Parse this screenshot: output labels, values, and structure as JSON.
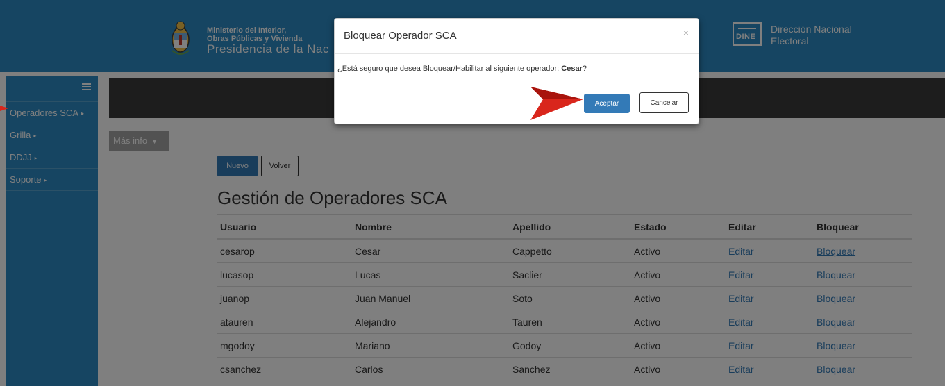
{
  "header": {
    "ministry_line1": "Ministerio del Interior,",
    "ministry_line2": "Obras Públicas y Vivienda",
    "ministry_line3": "Presidencia de la Nac",
    "dine_logo_text": "DINE",
    "dine_line1": "Dirección Nacional",
    "dine_line2": "Electoral"
  },
  "sidebar": {
    "items": [
      {
        "label": "Operadores SCA"
      },
      {
        "label": "Grilla"
      },
      {
        "label": "DDJJ"
      },
      {
        "label": "Soporte"
      }
    ]
  },
  "toolbar": {
    "mas_info": "Más info",
    "nuevo": "Nuevo",
    "volver": "Volver"
  },
  "page": {
    "title": "Gestión de Operadores SCA"
  },
  "table": {
    "headers": [
      "Usuario",
      "Nombre",
      "Apellido",
      "Estado",
      "Editar",
      "Bloquear"
    ],
    "rows": [
      [
        "cesarop",
        "Cesar",
        "Cappetto",
        "Activo",
        "Editar",
        "Bloquear"
      ],
      [
        "lucasop",
        "Lucas",
        "Saclier",
        "Activo",
        "Editar",
        "Bloquear"
      ],
      [
        "juanop",
        "Juan Manuel",
        "Soto",
        "Activo",
        "Editar",
        "Bloquear"
      ],
      [
        "atauren",
        "Alejandro",
        "Tauren",
        "Activo",
        "Editar",
        "Bloquear"
      ],
      [
        "mgodoy",
        "Mariano",
        "Godoy",
        "Activo",
        "Editar",
        "Bloquear"
      ],
      [
        "csanchez",
        "Carlos",
        "Sanchez",
        "Activo",
        "Editar",
        "Bloquear"
      ]
    ]
  },
  "modal": {
    "title": "Bloquear Operador SCA",
    "close": "×",
    "message": "¿Está seguro que desea Bloquear/Habilitar al siguiente operador: ",
    "operator": "Cesar",
    "message_end": "?",
    "accept": "Aceptar",
    "cancel": "Cancelar"
  },
  "colors": {
    "header_blue": "#2d8bc4",
    "primary": "#337ab7",
    "dark_bar": "#3a3a3a",
    "arrow_red": "#d9261c"
  }
}
